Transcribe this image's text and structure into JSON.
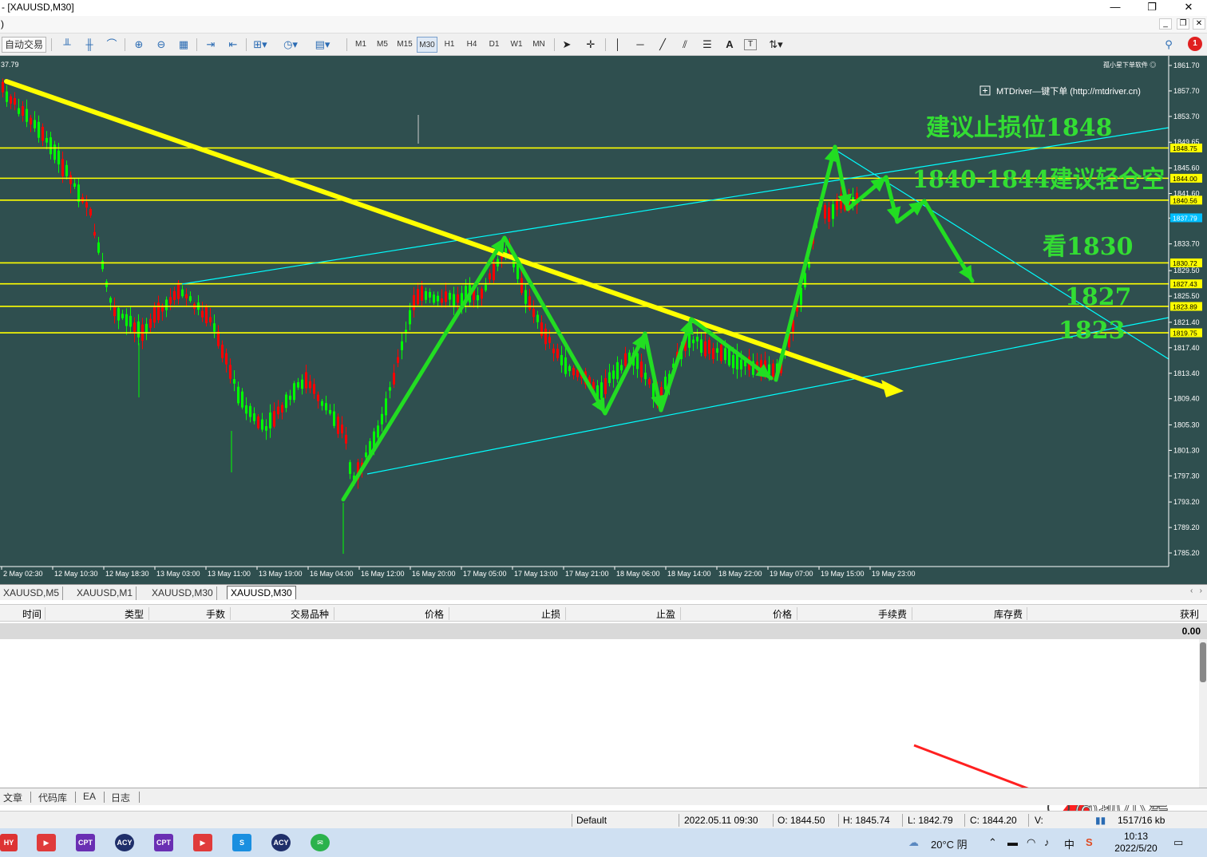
{
  "window": {
    "title": "- [XAUUSD,M30]",
    "menubar_char": ")",
    "controls": {
      "minimize": "—",
      "restore": "❐",
      "close": "✕"
    },
    "mdi": {
      "minimize": "_",
      "restore": "❐",
      "close": "✕"
    }
  },
  "toolbar": {
    "auto_trading": "自动交易",
    "timeframes": [
      "M1",
      "M5",
      "M15",
      "M30",
      "H1",
      "H4",
      "D1",
      "W1",
      "MN"
    ],
    "active_timeframe": "M30",
    "text_tool": "A",
    "label_tool": "T",
    "notification_count": "1"
  },
  "chart": {
    "corner_price": "37.79",
    "indicator_label": "孤小星下单软件 ◎",
    "ea_label": "MTDriver—键下单 (http://mtdriver.cn)",
    "colors": {
      "background": "#2f4f4f",
      "bull": "#ff0000",
      "bear": "#00ff00",
      "level": "#ffff00",
      "trendline": "#ffff00",
      "channel": "#00ffff",
      "arrow": "#22dd22",
      "annotation": "#33dd33"
    },
    "price_scale": [
      "1861.70",
      "1857.70",
      "1853.70",
      "1849.65",
      "1845.60",
      "1841.60",
      "1837.75",
      "1833.70",
      "1829.50",
      "1825.50",
      "1821.40",
      "1817.40",
      "1813.40",
      "1809.40",
      "1805.30",
      "1801.30",
      "1797.30",
      "1793.20",
      "1789.20",
      "1785.20"
    ],
    "level_tags": [
      "1848.75",
      "1844.00",
      "1840.56",
      "1837.79",
      "1830.72",
      "1827.43",
      "1823.89",
      "1819.75"
    ],
    "time_labels": [
      "2 May 02:30",
      "12 May 10:30",
      "12 May 18:30",
      "13 May 03:00",
      "13 May 11:00",
      "13 May 19:00",
      "16 May 04:00",
      "16 May 12:00",
      "16 May 20:00",
      "17 May 05:00",
      "17 May 13:00",
      "17 May 21:00",
      "18 May 06:00",
      "18 May 14:00",
      "18 May 22:00",
      "19 May 07:00",
      "19 May 15:00",
      "19 May 23:00"
    ],
    "annotations": [
      "建议止损位1848",
      "1840-1844建议轻仓空",
      "看1830",
      "1827",
      "1823"
    ]
  },
  "chart_tabs": [
    "XAUUSD,M5",
    "XAUUSD,M1",
    "XAUUSD,M30",
    "XAUUSD,M30"
  ],
  "chart_tabs_active": 3,
  "terminal": {
    "columns": [
      "时间",
      "类型",
      "手数",
      "交易品种",
      "价格",
      "止损",
      "止盈",
      "价格",
      "手续费",
      "库存费",
      "获利"
    ],
    "balance_profit": "0.00",
    "tabs": [
      "文章",
      "代码库",
      "EA",
      "日志"
    ]
  },
  "statusbar": {
    "profile": "Default",
    "datetime": "2022.05.11 09:30",
    "open": "O: 1844.50",
    "high": "H: 1845.74",
    "low": "L: 1842.79",
    "close": "C: 1844.20",
    "volume": "V:",
    "traffic": "1517/16 kb"
  },
  "watermark": "@孤小星",
  "taskbar": {
    "apps": [
      "HY",
      "▶",
      "CPT",
      "ACY",
      "CPT",
      "▶",
      "S",
      "ACY",
      "✉"
    ],
    "weather": "20°C 阴",
    "ime": "中",
    "time": "10:13",
    "date": "2022/5/20"
  }
}
